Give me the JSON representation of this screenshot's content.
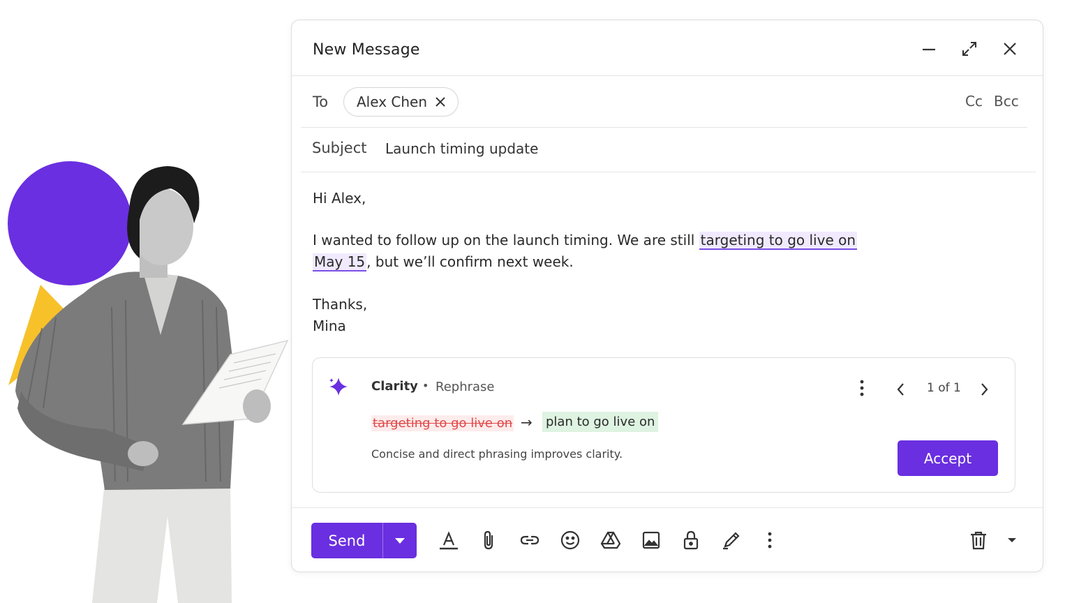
{
  "compose": {
    "title": "New Message",
    "to_label": "To",
    "recipient": "Alex Chen",
    "cc_label": "Cc",
    "bcc_label": "Bcc",
    "subject_label": "Subject",
    "subject_value": "Launch timing update",
    "body": {
      "greeting": "Hi Alex,",
      "line1_before": "I wanted to follow up on the launch timing. We are still ",
      "highlight_part1": "targeting to go live on",
      "highlight_part2": "May 15",
      "line2_after": ", but we’ll confirm next week.",
      "signoff": "Thanks,",
      "signature": "Mina"
    }
  },
  "suggestion": {
    "brand": "Clarity",
    "separator": "•",
    "mode": "Rephrase",
    "counter": "1 of 1",
    "original_text": "targeting to go live on",
    "arrow": "→",
    "replacement_text": "plan to go live on",
    "reason": "Concise and direct phrasing improves clarity.",
    "accept_label": "Accept"
  },
  "toolbar": {
    "send_label": "Send",
    "icons": [
      "text-format-icon",
      "attach-icon",
      "link-icon",
      "emoji-icon",
      "drive-icon",
      "image-icon",
      "lock-icon",
      "signature-icon",
      "more-options-icon",
      "trash-icon",
      "dropdown-arrow-icon"
    ]
  },
  "colors": {
    "accent": "#6a2fe0",
    "highlight_bg": "#f1eaff",
    "removed_text": "#e14848",
    "added_bg": "#def3e1",
    "deco_circle": "#6a2fe0",
    "deco_triangle": "#f7c12a"
  }
}
